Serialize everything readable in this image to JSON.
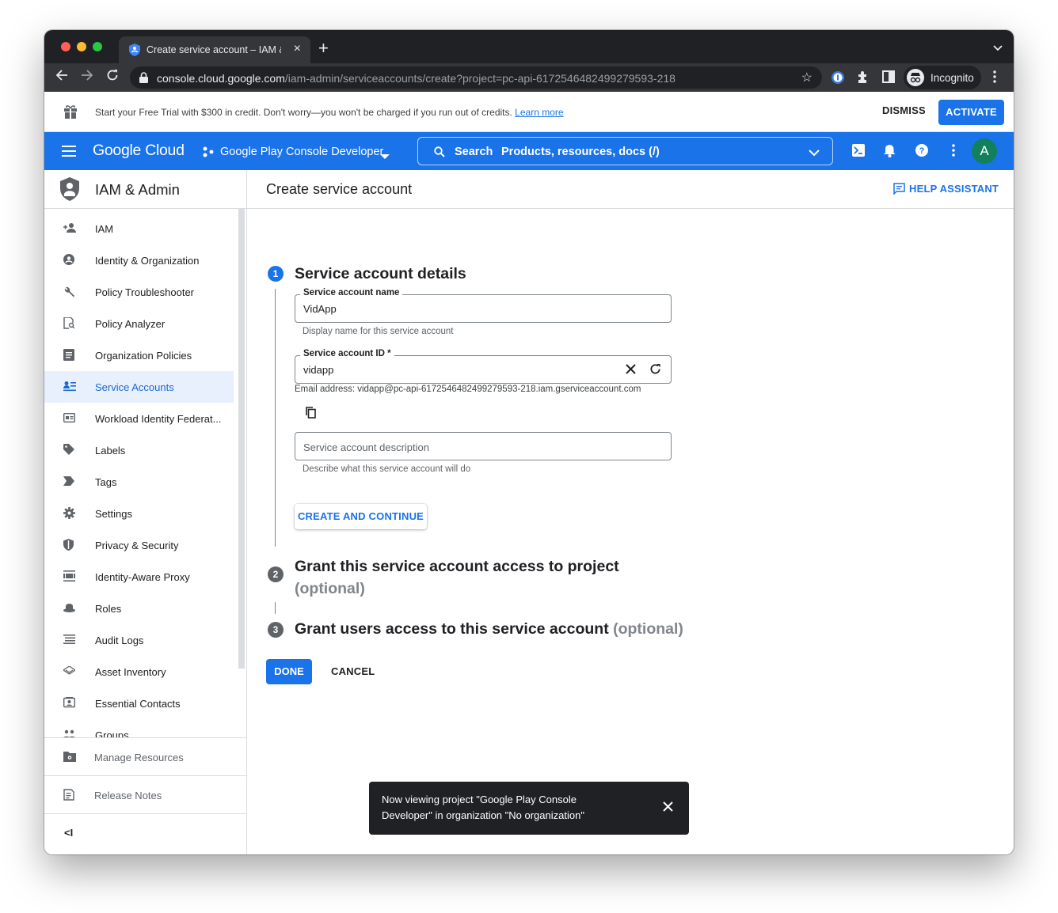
{
  "browser": {
    "tab_title": "Create service account – IAM &",
    "url_host": "console.cloud.google.com",
    "url_path": "/iam-admin/serviceaccounts/create?project=pc-api-6172546482499279593-218",
    "profile_label": "Incognito"
  },
  "banner": {
    "text": "Start your Free Trial with $300 in credit. Don't worry—you won't be charged if you run out of credits.",
    "link": "Learn more",
    "dismiss": "DISMISS",
    "activate": "ACTIVATE"
  },
  "topbar": {
    "logo": "Google Cloud",
    "project": "Google Play Console Developer",
    "search_label": "Search",
    "search_hint": "Products, resources, docs (/)",
    "avatar_letter": "A",
    "accent": "#1a73e8"
  },
  "sidebar": {
    "title": "IAM & Admin",
    "items": [
      {
        "label": "IAM",
        "icon": "person-add-icon"
      },
      {
        "label": "Identity & Organization",
        "icon": "account-circle-icon"
      },
      {
        "label": "Policy Troubleshooter",
        "icon": "wrench-icon"
      },
      {
        "label": "Policy Analyzer",
        "icon": "document-search-icon"
      },
      {
        "label": "Organization Policies",
        "icon": "list-document-icon"
      },
      {
        "label": "Service Accounts",
        "icon": "service-account-icon",
        "active": true
      },
      {
        "label": "Workload Identity Federat...",
        "icon": "id-card-icon"
      },
      {
        "label": "Labels",
        "icon": "label-icon"
      },
      {
        "label": "Tags",
        "icon": "tag-icon"
      },
      {
        "label": "Settings",
        "icon": "gear-icon"
      },
      {
        "label": "Privacy & Security",
        "icon": "shield-icon"
      },
      {
        "label": "Identity-Aware Proxy",
        "icon": "proxy-icon"
      },
      {
        "label": "Roles",
        "icon": "roles-hat-icon"
      },
      {
        "label": "Audit Logs",
        "icon": "lines-icon"
      },
      {
        "label": "Asset Inventory",
        "icon": "diamond-stack-icon"
      },
      {
        "label": "Essential Contacts",
        "icon": "contact-card-icon"
      },
      {
        "label": "Groups",
        "icon": "groups-icon"
      }
    ],
    "manage_resources": "Manage Resources",
    "release_notes": "Release Notes",
    "collapse_glyph": "<I"
  },
  "main": {
    "page_title": "Create service account",
    "help_assistant": "HELP ASSISTANT",
    "step1": {
      "number": "1",
      "title": "Service account details",
      "name_label": "Service account name",
      "name_value": "VidApp",
      "name_hint": "Display name for this service account",
      "id_label": "Service account ID *",
      "id_value": "vidapp",
      "email": "Email address: vidapp@pc-api-6172546482499279593-218.iam.gserviceaccount.com",
      "description_placeholder": "Service account description",
      "description_hint": "Describe what this service account will do",
      "continue_button": "CREATE AND CONTINUE"
    },
    "step2": {
      "number": "2",
      "title": "Grant this service account access to project",
      "optional": "(optional)"
    },
    "step3": {
      "number": "3",
      "title": "Grant users access to this service account",
      "optional": "(optional)"
    },
    "done": "DONE",
    "cancel": "CANCEL"
  },
  "toast": {
    "message": "Now viewing project \"Google Play Console Developer\" in organization \"No organization\""
  }
}
